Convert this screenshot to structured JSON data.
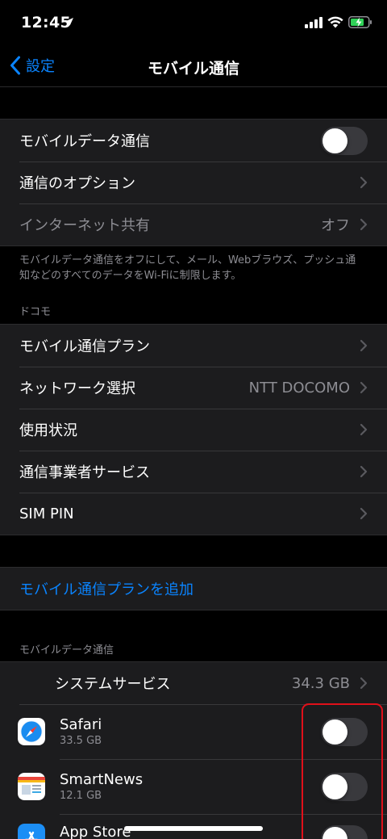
{
  "status": {
    "time": "12:45"
  },
  "nav": {
    "back_label": "設定",
    "title": "モバイル通信"
  },
  "group1": {
    "mobile_data": "モバイルデータ通信",
    "options": "通信のオプション",
    "hotspot": "インターネット共有",
    "hotspot_value": "オフ"
  },
  "footnote": "モバイルデータ通信をオフにして、メール、Webブラウズ、プッシュ通知などのすべてのデータをWi-Fiに制限します。",
  "carrier": {
    "header": "ドコモ",
    "plan": "モバイル通信プラン",
    "network": "ネットワーク選択",
    "network_value": "NTT DOCOMO",
    "usage": "使用状況",
    "services": "通信事業者サービス",
    "sim_pin": "SIM PIN"
  },
  "add_plan": "モバイル通信プランを追加",
  "apps": {
    "header": "モバイルデータ通信",
    "system": {
      "label": "システムサービス",
      "value": "34.3 GB"
    },
    "list": [
      {
        "name": "Safari",
        "size": "33.5 GB"
      },
      {
        "name": "SmartNews",
        "size": "12.1 GB"
      },
      {
        "name": "App Store",
        "size": ""
      }
    ]
  },
  "colors": {
    "accent": "#0a84ff",
    "highlight": "#e0101a",
    "charging": "#30d158"
  }
}
